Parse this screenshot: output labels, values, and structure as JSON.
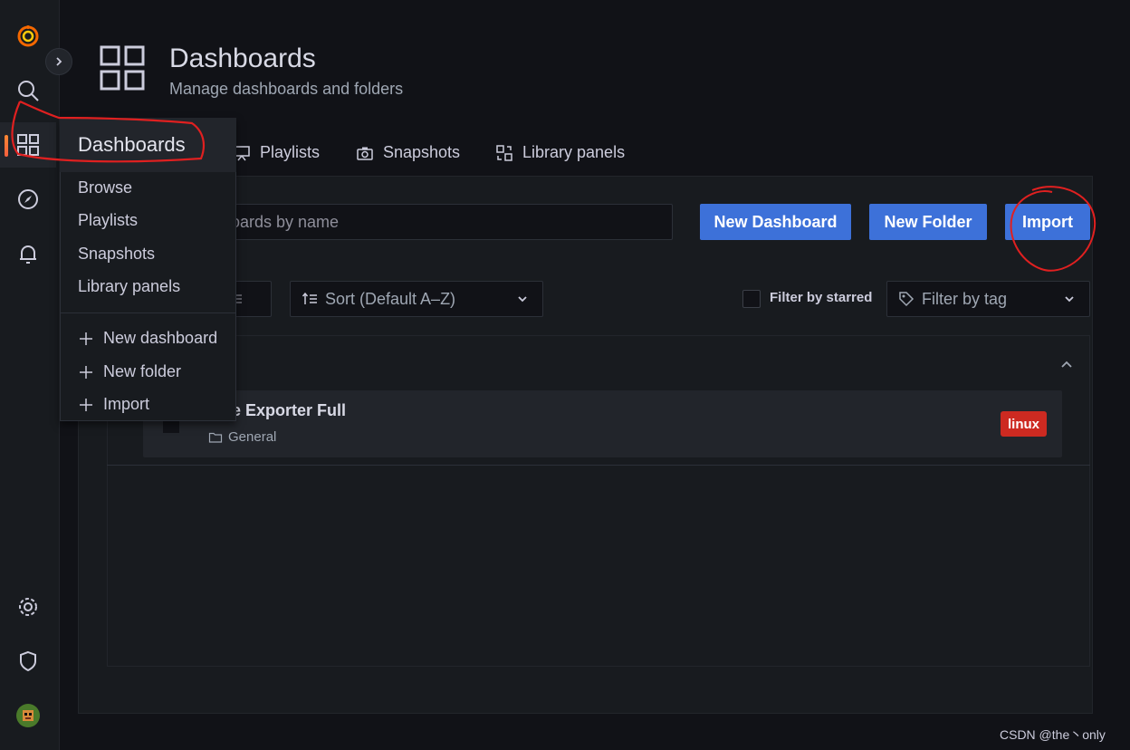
{
  "sidebar": {
    "icons": [
      "grafana-logo-icon",
      "search-icon",
      "dashboards-grid-icon",
      "explore-compass-icon",
      "alerting-bell-icon",
      "settings-gear-icon",
      "shield-icon",
      "user-avatar-icon"
    ],
    "active": "dashboards-grid-icon",
    "accent_color": "#ff8833"
  },
  "header": {
    "title": "Dashboards",
    "subtitle": "Manage dashboards and folders"
  },
  "tabs": [
    {
      "label": "Playlists",
      "icon": "presentation-icon"
    },
    {
      "label": "Snapshots",
      "icon": "camera-icon"
    },
    {
      "label": "Library panels",
      "icon": "library-panels-icon"
    }
  ],
  "search": {
    "placeholder": "oards by name"
  },
  "buttons": {
    "new_dashboard": "New Dashboard",
    "new_folder": "New Folder",
    "import": "Import",
    "color": "#3d71d9"
  },
  "toolbar": {
    "view_icon": "list-view-icon",
    "sort_label": "Sort (Default A–Z)",
    "filter_starred": "Filter by starred",
    "filter_tag": "Filter by tag"
  },
  "folder": {
    "dashboards": [
      {
        "title": "e Exporter Full",
        "folder": "General",
        "tags": [
          "linux"
        ]
      }
    ],
    "tag_color": "#cd2a21"
  },
  "flyout": {
    "header": "Dashboards",
    "items": [
      "Browse",
      "Playlists",
      "Snapshots",
      "Library panels"
    ],
    "actions": [
      "New dashboard",
      "New folder",
      "Import"
    ]
  },
  "watermark": "CSDN @the丶only"
}
